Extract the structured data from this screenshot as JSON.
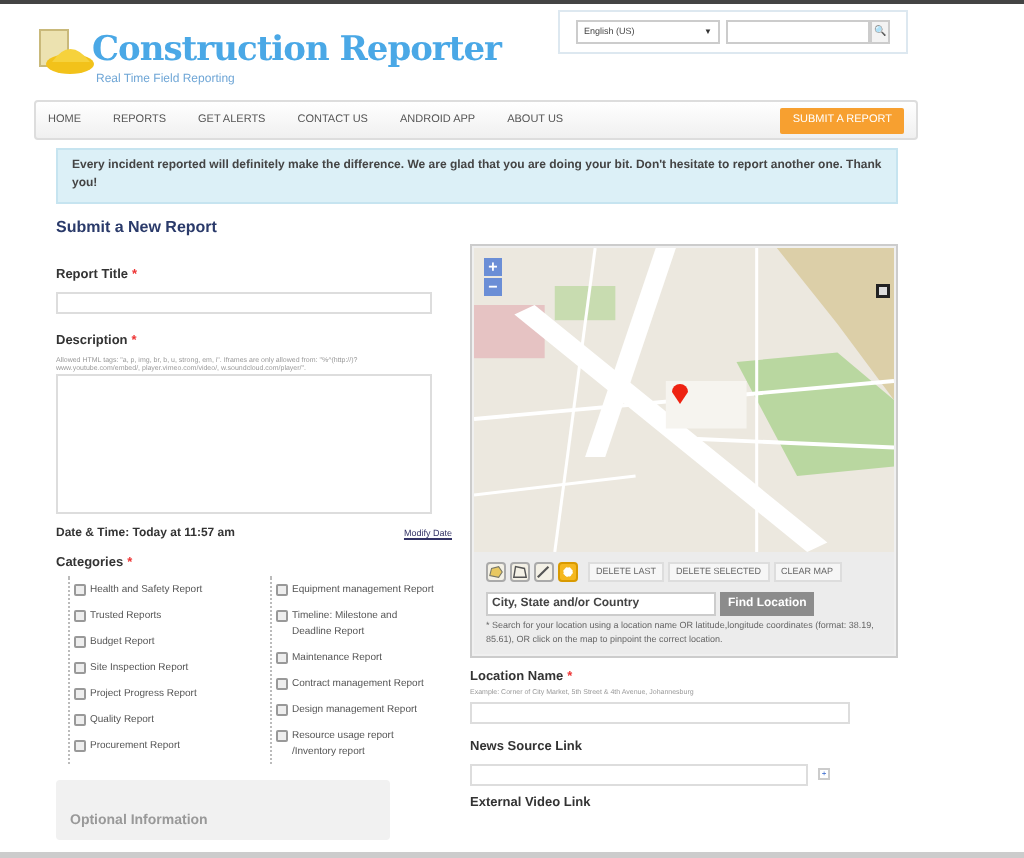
{
  "header": {
    "logo_title": "Construction Reporter",
    "logo_tagline": "Real Time Field Reporting",
    "language": "English (US)",
    "language_arrow": "▼",
    "search_button": "🔍"
  },
  "nav": {
    "items": [
      {
        "label": "HOME",
        "selected": false
      },
      {
        "label": "REPORTS",
        "selected": false
      },
      {
        "label": "GET ALERTS",
        "selected": false
      },
      {
        "label": "CONTACT US",
        "selected": false
      },
      {
        "label": "ANDROID APP",
        "selected": false
      },
      {
        "label": "ABOUT US",
        "selected": false
      }
    ],
    "submit_button": "SUBMIT A REPORT"
  },
  "notice": "Every incident reported will definitely make the difference. We are glad that you are doing your bit. Don't hesitate to report another one. Thank you!",
  "form": {
    "heading": "Submit a New Report",
    "report_title": {
      "label": "Report Title",
      "required_mark": "*"
    },
    "description": {
      "label": "Description",
      "required_mark": "*",
      "hint": "Allowed HTML tags: \"a, p, img, br, b, u, strong, em, i\". Iframes are only allowed from: \"%^(http://)?www.youtube.com/embed/, player.vimeo.com/video/, w.soundcloud.com/player/\"."
    },
    "date_time": "Date & Time: Today at 11:57 am",
    "modify_date": "Modify Date",
    "categories": {
      "label": "Categories",
      "required_mark": "*",
      "columns": [
        [
          {
            "label": "Health and Safety Report",
            "checked": false
          },
          {
            "label": "Trusted Reports",
            "checked": false
          },
          {
            "label": "Budget Report",
            "checked": false
          },
          {
            "label": "Site Inspection Report",
            "checked": false
          },
          {
            "label": "Project Progress Report",
            "checked": false
          },
          {
            "label": "Quality Report",
            "checked": false
          },
          {
            "label": "Procurement Report",
            "checked": false
          }
        ],
        [
          {
            "label": "Equipment management Report",
            "checked": false
          },
          {
            "label": "Timeline: Milestone and Deadline Report",
            "checked": false
          },
          {
            "label": "Maintenance Report",
            "checked": false
          },
          {
            "label": "Contract management Report",
            "checked": false
          },
          {
            "label": "Design management Report",
            "checked": false
          },
          {
            "label": "Resource usage report /Inventory report",
            "checked": false
          }
        ]
      ]
    },
    "optional_heading": "Optional Information"
  },
  "map": {
    "zoom_in": "+",
    "zoom_out": "−",
    "tools": [
      {
        "kind": "hand",
        "selected": false
      },
      {
        "kind": "polygon",
        "selected": false
      },
      {
        "kind": "line",
        "selected": false
      },
      {
        "kind": "point",
        "selected": true
      }
    ],
    "actions": [
      "DELETE LAST",
      "DELETE SELECTED",
      "CLEAR MAP"
    ],
    "location_search": {
      "value": "City, State and/or Country",
      "button": "Find Location"
    },
    "help": "* Search for your location using a location name OR latitude,longitude coordinates (format: 38.19, 85.61), OR click on the map to pinpoint the correct location."
  },
  "location_name": {
    "label": "Location Name",
    "required_mark": "*",
    "hint": "Example: Corner of City Market, 5th Street & 4th Avenue, Johannesburg"
  },
  "news_link": {
    "label": "News Source Link",
    "add": "+"
  },
  "video_link": {
    "label": "External Video Link"
  }
}
